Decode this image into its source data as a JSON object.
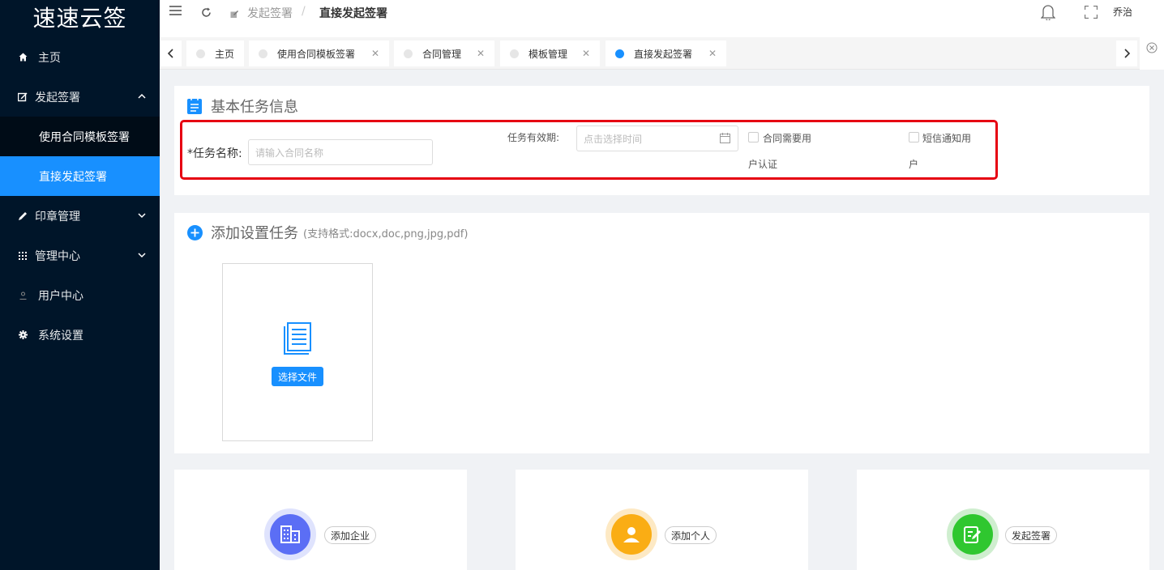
{
  "app": {
    "logo": "速速云签"
  },
  "sidebar": {
    "items": [
      {
        "label": "主页",
        "icon": "home-icon"
      },
      {
        "label": "发起签署",
        "icon": "edit-icon"
      },
      {
        "label": "使用合同模板签署"
      },
      {
        "label": "直接发起签署"
      },
      {
        "label": "印章管理",
        "icon": "pen-icon"
      },
      {
        "label": "管理中心",
        "icon": "grid-icon"
      },
      {
        "label": "用户中心",
        "icon": "user-icon"
      },
      {
        "label": "系统设置",
        "icon": "gear-icon"
      }
    ]
  },
  "header": {
    "breadcrumb_parent": "发起签署",
    "breadcrumb_sep": "/",
    "breadcrumb_current": "直接发起签署",
    "username": "乔治"
  },
  "tabs": [
    {
      "label": "主页",
      "active": false,
      "closable": false
    },
    {
      "label": "使用合同模板签署",
      "active": false,
      "closable": true
    },
    {
      "label": "合同管理",
      "active": false,
      "closable": true
    },
    {
      "label": "模板管理",
      "active": false,
      "closable": true
    },
    {
      "label": "直接发起签署",
      "active": true,
      "closable": true
    }
  ],
  "basic_info": {
    "title": "基本任务信息",
    "task_name_label": "*任务名称:",
    "task_name_placeholder": "请输入合同名称",
    "validity_label": "任务有效期:",
    "validity_placeholder": "点击选择时间",
    "checkbox_auth_line1": "合同需要用",
    "checkbox_auth_line2": "户认证",
    "checkbox_sms_line1": "短信通知用",
    "checkbox_sms_line2": "户"
  },
  "add_task": {
    "title": "添加设置任务",
    "formats": "(支持格式:docx,doc,png,jpg,pdf)",
    "select_file": "选择文件"
  },
  "actions": [
    {
      "label": "添加企业",
      "color": "#5b6ef5",
      "ring": "#dfe3fd",
      "icon": "building-icon"
    },
    {
      "label": "添加个人",
      "color": "#faad14",
      "ring": "#fde9c4",
      "icon": "person-icon"
    },
    {
      "label": "发起签署",
      "color": "#2fc72f",
      "ring": "#cfeecf",
      "icon": "sign-icon"
    }
  ],
  "colors": {
    "primary": "#1890ff",
    "sidebar": "#001529",
    "highlight": "#e60012"
  }
}
